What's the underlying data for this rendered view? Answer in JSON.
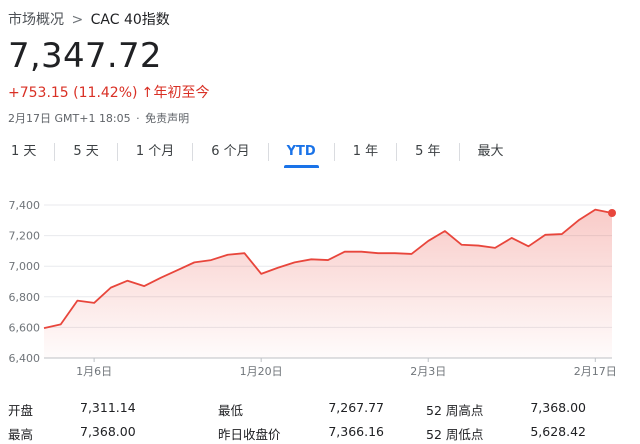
{
  "breadcrumb": {
    "parent": "市场概况",
    "separator": ">",
    "current": "CAC 40指数"
  },
  "quote": {
    "price": "7,347.72",
    "change": "+753.15 (11.42%)",
    "arrow": "↑",
    "period": "年初至今",
    "timestamp": "2月17日 GMT+1 18:05",
    "dot": "·",
    "disclaimer": "免责声明"
  },
  "tabs": [
    {
      "label": "1 天"
    },
    {
      "label": "5 天"
    },
    {
      "label": "1 个月"
    },
    {
      "label": "6 个月"
    },
    {
      "label": "YTD",
      "active": true
    },
    {
      "label": "1 年"
    },
    {
      "label": "5 年"
    },
    {
      "label": "最大"
    }
  ],
  "colors": {
    "line": "#e8463c",
    "accent_blue": "#1a73e8",
    "negative_red": "#d93025"
  },
  "chart_data": {
    "type": "area",
    "ylim": [
      6400,
      7400
    ],
    "yticks": [
      "6,400",
      "6,600",
      "6,800",
      "7,000",
      "7,200",
      "7,400"
    ],
    "ytick_values": [
      6400,
      6600,
      6800,
      7000,
      7200,
      7400
    ],
    "xtick_labels": [
      "1月6日",
      "1月20日",
      "2月3日",
      "2月17日"
    ],
    "xtick_indices": [
      3,
      13,
      23,
      33
    ],
    "grid": true,
    "series": [
      {
        "values": [
          6595,
          6620,
          6775,
          6760,
          6860,
          6905,
          6870,
          6925,
          6975,
          7025,
          7040,
          7075,
          7085,
          6950,
          6990,
          7025,
          7045,
          7040,
          7095,
          7095,
          7085,
          7085,
          7080,
          7165,
          7230,
          7140,
          7135,
          7120,
          7185,
          7130,
          7205,
          7210,
          7300,
          7370,
          7347.72
        ]
      }
    ]
  },
  "stats": {
    "rows": [
      [
        {
          "label": "开盘",
          "value": "7,311.14"
        },
        {
          "label": "最低",
          "value": "7,267.77"
        },
        {
          "label": "52 周高点",
          "value": "7,368.00"
        }
      ],
      [
        {
          "label": "最高",
          "value": "7,368.00"
        },
        {
          "label": "昨日收盘价",
          "value": "7,366.16"
        },
        {
          "label": "52 周低点",
          "value": "5,628.42"
        }
      ]
    ]
  }
}
